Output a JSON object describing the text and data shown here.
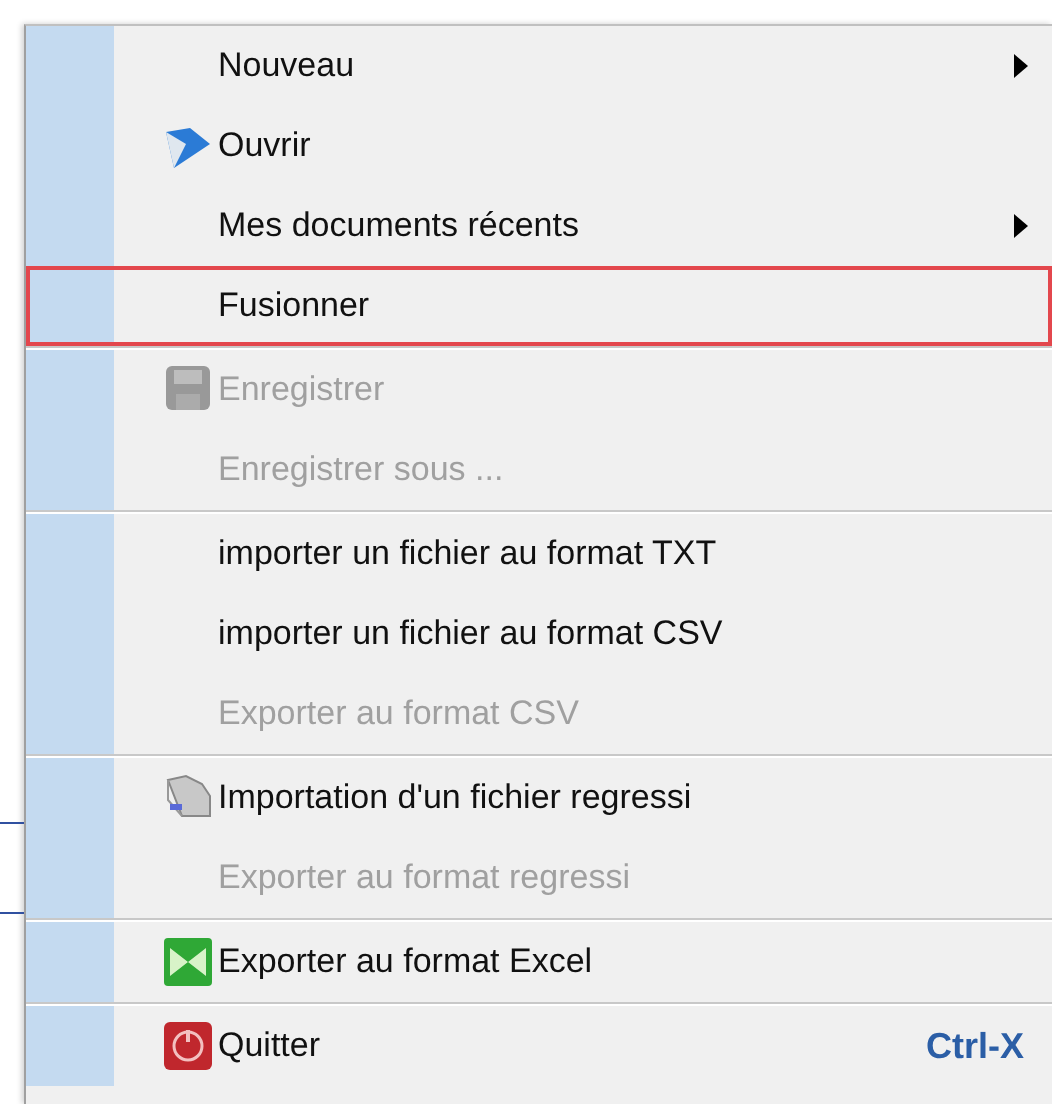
{
  "menu": {
    "items": [
      {
        "kind": "item",
        "label": "Nouveau",
        "disabled": false,
        "submenu": true,
        "highlighted": false
      },
      {
        "kind": "item",
        "label": "Ouvrir",
        "disabled": false,
        "submenu": false,
        "highlighted": false
      },
      {
        "kind": "item",
        "label": "Mes documents récents",
        "disabled": false,
        "submenu": true,
        "highlighted": false
      },
      {
        "kind": "item",
        "label": "Fusionner",
        "disabled": false,
        "submenu": false,
        "highlighted": true
      },
      {
        "kind": "separator"
      },
      {
        "kind": "item",
        "label": "Enregistrer",
        "disabled": true,
        "submenu": false,
        "highlighted": false
      },
      {
        "kind": "item",
        "label": "Enregistrer sous ...",
        "disabled": true,
        "submenu": false,
        "highlighted": false
      },
      {
        "kind": "separator"
      },
      {
        "kind": "item",
        "label": "importer un fichier au format TXT",
        "disabled": false,
        "submenu": false,
        "highlighted": false
      },
      {
        "kind": "item",
        "label": "importer un fichier au format CSV",
        "disabled": false,
        "submenu": false,
        "highlighted": false
      },
      {
        "kind": "item",
        "label": "Exporter au format CSV",
        "disabled": true,
        "submenu": false,
        "highlighted": false
      },
      {
        "kind": "separator"
      },
      {
        "kind": "item",
        "label": "Importation d'un fichier regressi",
        "disabled": false,
        "submenu": false,
        "highlighted": false
      },
      {
        "kind": "item",
        "label": "Exporter au format regressi",
        "disabled": true,
        "submenu": false,
        "highlighted": false
      },
      {
        "kind": "separator"
      },
      {
        "kind": "item",
        "label": "Exporter au format Excel",
        "disabled": false,
        "submenu": false,
        "highlighted": false
      },
      {
        "kind": "separator"
      },
      {
        "kind": "item",
        "label": "Quitter",
        "shortcut": "Ctrl-X",
        "disabled": false,
        "submenu": false,
        "highlighted": false
      }
    ]
  }
}
